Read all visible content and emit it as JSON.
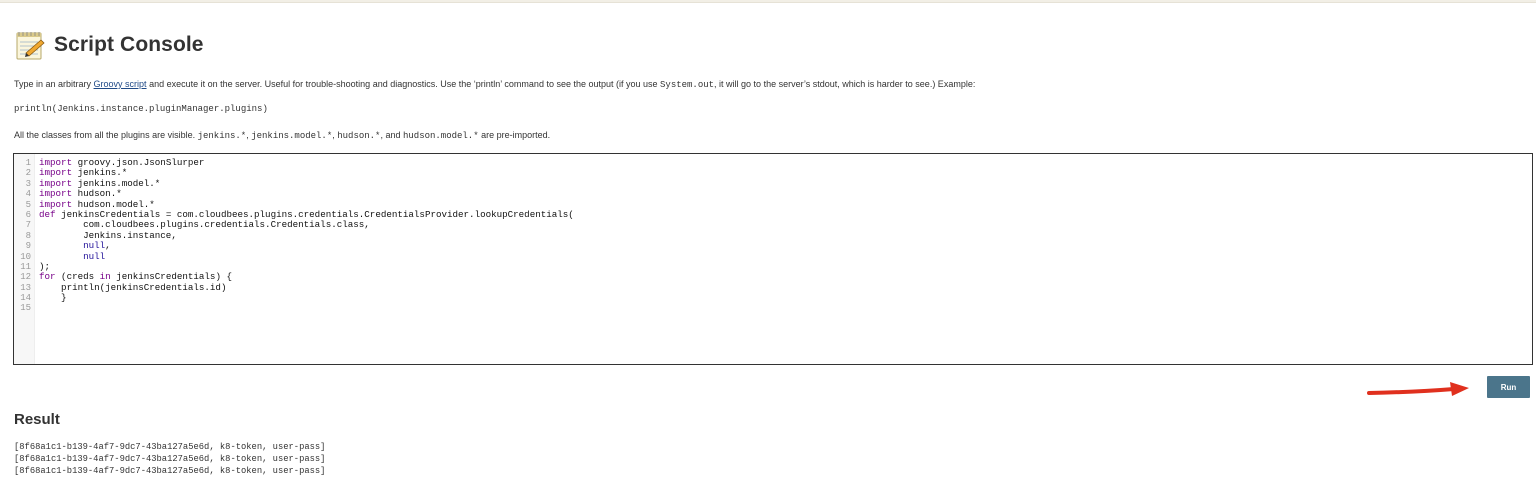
{
  "header": {
    "title": "Script Console",
    "icon": "notepad-icon"
  },
  "description": {
    "prefix": "Type in an arbitrary ",
    "link": "Groovy script",
    "middle": " and execute it on the server. Useful for trouble-shooting and diagnostics. Use the ‘println’ command to see the output (if you use ",
    "code": "System.out",
    "suffix": ", it will go to the server’s stdout, which is harder to see.) Example:"
  },
  "example": "println(Jenkins.instance.pluginManager.plugins)",
  "imports": {
    "prefix": "All the classes from all the plugins are visible. ",
    "p1": "jenkins.*",
    "s1": ", ",
    "p2": "jenkins.model.*",
    "s2": ", ",
    "p3": "hudson.*",
    "s3": ", and ",
    "p4": "hudson.model.*",
    "suffix": " are pre-imported."
  },
  "editor": {
    "line_numbers": [
      "1",
      "2",
      "3",
      "4",
      "5",
      "6",
      "7",
      "8",
      "9",
      "10",
      "11",
      "12",
      "13",
      "14",
      "15"
    ],
    "lines": [
      [
        {
          "t": "import",
          "c": "kw"
        },
        {
          "t": " groovy.json.JsonSlurper",
          "c": ""
        }
      ],
      [
        {
          "t": "import",
          "c": "kw"
        },
        {
          "t": " jenkins.*",
          "c": ""
        }
      ],
      [
        {
          "t": "import",
          "c": "kw"
        },
        {
          "t": " jenkins.model.*",
          "c": ""
        }
      ],
      [
        {
          "t": "import",
          "c": "kw"
        },
        {
          "t": " hudson.*",
          "c": ""
        }
      ],
      [
        {
          "t": "import",
          "c": "kw"
        },
        {
          "t": " hudson.model.*",
          "c": ""
        }
      ],
      [
        {
          "t": "def",
          "c": "kw"
        },
        {
          "t": " jenkinsCredentials = com.cloudbees.plugins.credentials.CredentialsProvider.lookupCredentials(",
          "c": ""
        }
      ],
      [
        {
          "t": "        com.cloudbees.plugins.credentials.Credentials.class,",
          "c": ""
        }
      ],
      [
        {
          "t": "        Jenkins.instance,",
          "c": ""
        }
      ],
      [
        {
          "t": "        ",
          "c": ""
        },
        {
          "t": "null",
          "c": "atom"
        },
        {
          "t": ",",
          "c": ""
        }
      ],
      [
        {
          "t": "        ",
          "c": ""
        },
        {
          "t": "null",
          "c": "atom"
        }
      ],
      [
        {
          "t": ");",
          "c": ""
        }
      ],
      [
        {
          "t": "for",
          "c": "kw"
        },
        {
          "t": " (creds ",
          "c": ""
        },
        {
          "t": "in",
          "c": "kw"
        },
        {
          "t": " jenkinsCredentials) {",
          "c": ""
        }
      ],
      [
        {
          "t": "    println(jenkinsCredentials.id)",
          "c": ""
        }
      ],
      [
        {
          "t": "    }",
          "c": ""
        }
      ],
      [
        {
          "t": "",
          "c": ""
        }
      ]
    ]
  },
  "run_button": {
    "label": "Run"
  },
  "result": {
    "title": "Result",
    "lines": [
      "[8f68a1c1-b139-4af7-9dc7-43ba127a5e6d, k8-token, user-pass]",
      "[8f68a1c1-b139-4af7-9dc7-43ba127a5e6d, k8-token, user-pass]",
      "[8f68a1c1-b139-4af7-9dc7-43ba127a5e6d, k8-token, user-pass]"
    ]
  },
  "colors": {
    "run_button": "#4b758b",
    "arrow": "#e0301e",
    "link": "#204a87"
  }
}
